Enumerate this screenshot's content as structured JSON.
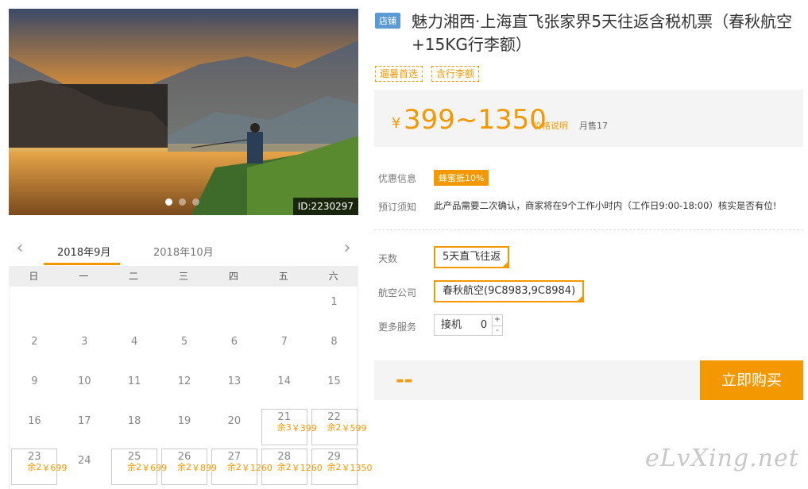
{
  "hero": {
    "image_id": "ID:2230297",
    "slides": 3,
    "active_slide": 1
  },
  "calendar": {
    "months": [
      "2018年9月",
      "2018年10月"
    ],
    "prev_icon": "chevron-left-icon",
    "next_icon": "chevron-right-icon",
    "weekdays": [
      "日",
      "一",
      "二",
      "三",
      "四",
      "五",
      "六"
    ],
    "days": [
      {
        "d": "1",
        "price": "",
        "rem": ""
      },
      {
        "d": "2",
        "price": "",
        "rem": ""
      },
      {
        "d": "3",
        "price": "",
        "rem": ""
      },
      {
        "d": "4",
        "price": "",
        "rem": ""
      },
      {
        "d": "5",
        "price": "",
        "rem": ""
      },
      {
        "d": "6",
        "price": "",
        "rem": ""
      },
      {
        "d": "7",
        "price": "",
        "rem": ""
      },
      {
        "d": "8",
        "price": "",
        "rem": ""
      },
      {
        "d": "9",
        "price": "",
        "rem": ""
      },
      {
        "d": "10",
        "price": "",
        "rem": ""
      },
      {
        "d": "11",
        "price": "",
        "rem": ""
      },
      {
        "d": "12",
        "price": "",
        "rem": ""
      },
      {
        "d": "13",
        "price": "",
        "rem": ""
      },
      {
        "d": "14",
        "price": "",
        "rem": ""
      },
      {
        "d": "15",
        "price": "",
        "rem": ""
      },
      {
        "d": "16",
        "price": "",
        "rem": ""
      },
      {
        "d": "17",
        "price": "",
        "rem": ""
      },
      {
        "d": "18",
        "price": "",
        "rem": ""
      },
      {
        "d": "19",
        "price": "",
        "rem": ""
      },
      {
        "d": "20",
        "price": "",
        "rem": ""
      },
      {
        "d": "21",
        "price": "￥399",
        "rem": "余3"
      },
      {
        "d": "22",
        "price": "￥599",
        "rem": "余2"
      },
      {
        "d": "23",
        "price": "￥699",
        "rem": "余2"
      },
      {
        "d": "24",
        "price": "",
        "rem": ""
      },
      {
        "d": "25",
        "price": "￥699",
        "rem": "余2"
      },
      {
        "d": "26",
        "price": "￥899",
        "rem": "余2"
      },
      {
        "d": "27",
        "price": "￥1260",
        "rem": "余2"
      },
      {
        "d": "28",
        "price": "￥1260",
        "rem": "余2"
      },
      {
        "d": "29",
        "price": "￥1350",
        "rem": "余2"
      }
    ]
  },
  "product": {
    "shop_badge": "店铺",
    "title": "魅力湘西·上海直飞张家界5天往返含税机票（春秋航空+15KG行李额）",
    "tags": [
      "遛暑首选",
      "含行李额"
    ],
    "currency": "¥",
    "price": "399~1350",
    "price_explain": "价格说明",
    "sold": "月售17",
    "promo_label": "优惠信息",
    "promo_value": "蜂蜜抵10%",
    "notice_label": "预订须知",
    "notice_value": "此产品需要二次确认，商家将在9个工作小时内（工作日9:00-18:00）核实是否有位!",
    "days_label": "天数",
    "days_option": "5天直飞往返",
    "airline_label": "航空公司",
    "airline_option": "春秋航空(9C8983,9C8984)",
    "services_label": "更多服务",
    "service_name": "接机",
    "service_qty": "0",
    "plus": "+",
    "minus": "-",
    "total": "--",
    "buy_label": "立即购买"
  },
  "watermark": "eLvXing.net"
}
